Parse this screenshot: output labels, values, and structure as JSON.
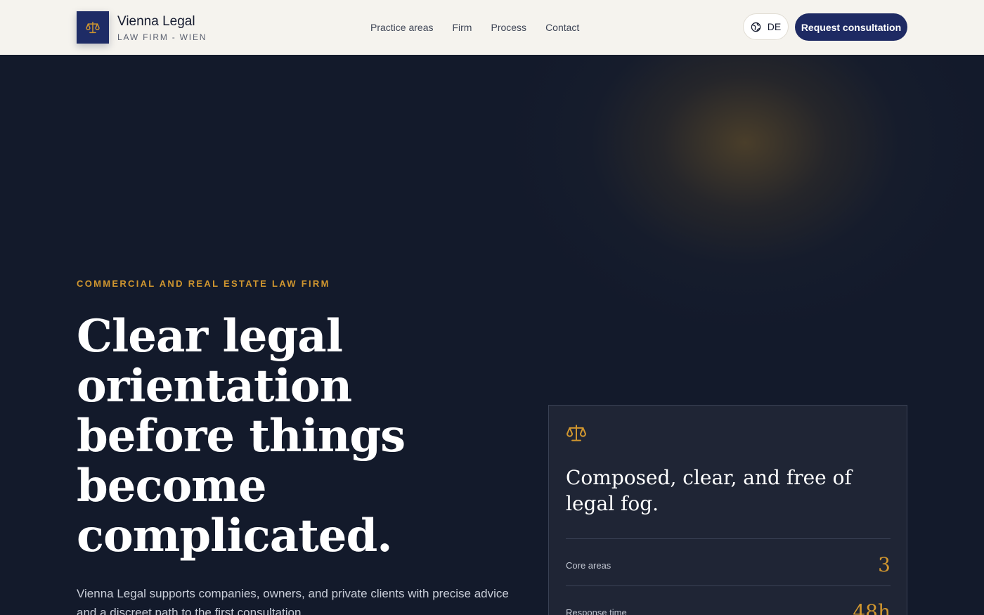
{
  "header": {
    "brand_name": "Vienna Legal",
    "brand_sub": "LAW FIRM - WIEN",
    "logo_icon": "scales-icon",
    "nav": [
      "Practice areas",
      "Firm",
      "Process",
      "Contact"
    ],
    "lang_label": "DE",
    "lang_icon": "globe-icon",
    "cta_label": "Request consultation"
  },
  "hero": {
    "eyebrow": "COMMERCIAL AND REAL ESTATE LAW FIRM",
    "headline": "Clear legal orientation before things become complicated.",
    "lead": "Vienna Legal supports companies, owners, and private clients with precise advice and a discreet path to the first consultation."
  },
  "card": {
    "icon": "scales-icon",
    "title": "Composed, clear, and free of legal fog.",
    "stats": [
      {
        "label": "Core areas",
        "value": "3"
      },
      {
        "label": "Response time",
        "value": "48h"
      }
    ]
  },
  "colors": {
    "accent": "#d0962f",
    "navy": "#1e2a63",
    "hero_bg": "#131a2b",
    "header_bg": "#f5f3ee"
  }
}
